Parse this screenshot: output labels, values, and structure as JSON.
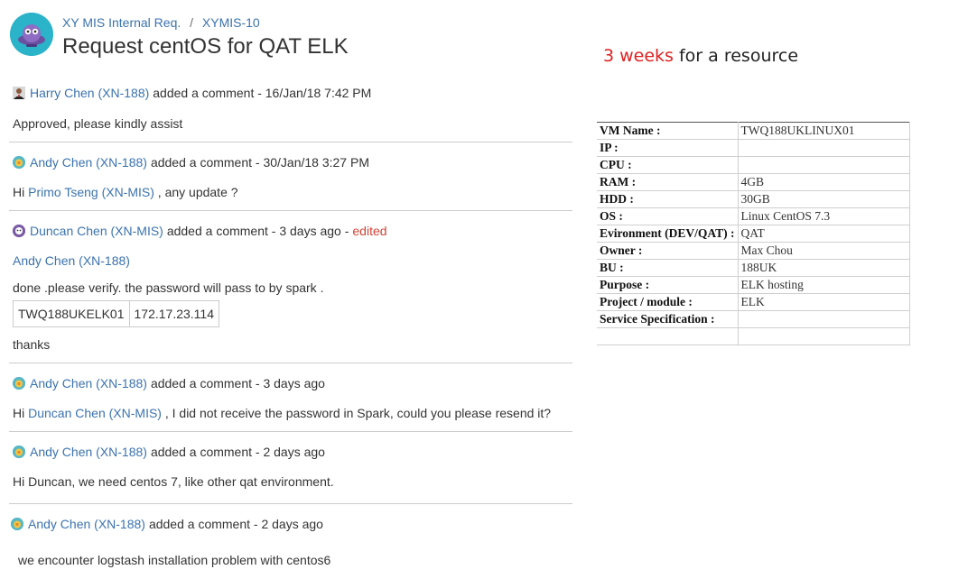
{
  "header": {
    "breadcrumb": [
      {
        "label": "XY MIS Internal Req."
      },
      {
        "label": "XYMIS-10"
      }
    ],
    "separator": "/",
    "title": "Request centOS for QAT ELK"
  },
  "tagline": {
    "highlight": "3 weeks",
    "rest": " for a resource"
  },
  "comments": [
    {
      "author": "Harry Chen (XN-188)",
      "meta": "added a comment - 16/Jan/18 7:42 PM",
      "body": "Approved, please kindly assist"
    },
    {
      "author": "Andy Chen (XN-188)",
      "meta": "added a comment - 30/Jan/18 3:27 PM",
      "body_prefix": "Hi ",
      "mention": "Primo Tseng (XN-MIS)",
      "body_suffix": " , any update ?"
    },
    {
      "author": "Duncan Chen (XN-MIS)",
      "meta": "added a comment - 3 days ago -",
      "edited": "edited",
      "mention": "Andy Chen (XN-188)",
      "body": "done .please verify. the password will pass to by spark .",
      "table": [
        "TWQ188UKELK01",
        "172.17.23.114"
      ],
      "closing": "thanks"
    },
    {
      "author": "Andy Chen (XN-188)",
      "meta": "added a comment - 3 days ago",
      "body_prefix": "Hi ",
      "mention": "Duncan Chen (XN-MIS)",
      "body_suffix": " , I did not receive the password in Spark, could you please resend it?"
    },
    {
      "author": "Andy Chen (XN-188)",
      "meta": "added a comment - 2 days ago",
      "body": "Hi Duncan, we need centos 7, like other qat environment."
    },
    {
      "author": "Andy Chen (XN-188)",
      "meta": "added a comment - 2 days ago",
      "body": "we encounter logstash installation problem with centos6"
    }
  ],
  "spec_table": [
    {
      "key": "VM Name :",
      "value": "TWQ188UKLINUX01"
    },
    {
      "key": "IP :",
      "value": ""
    },
    {
      "key": "CPU :",
      "value": ""
    },
    {
      "key": "RAM :",
      "value": "4GB"
    },
    {
      "key": "HDD :",
      "value": "30GB"
    },
    {
      "key": "OS :",
      "value": "Linux CentOS 7.3"
    },
    {
      "key": "Evironment (DEV/QAT) :",
      "value": "QAT"
    },
    {
      "key": "Owner :",
      "value": "Max Chou"
    },
    {
      "key": "BU :",
      "value": "188UK"
    },
    {
      "key": "Purpose :",
      "value": "ELK hosting"
    },
    {
      "key": "Project / module :",
      "value": "ELK"
    },
    {
      "key": "Service Specification :",
      "value": ""
    },
    {
      "key": "",
      "value": ""
    }
  ],
  "colors": {
    "link": "#3b73af",
    "edited": "#d04437",
    "highlight": "#e02020",
    "avatar": "#2bb3c9"
  }
}
